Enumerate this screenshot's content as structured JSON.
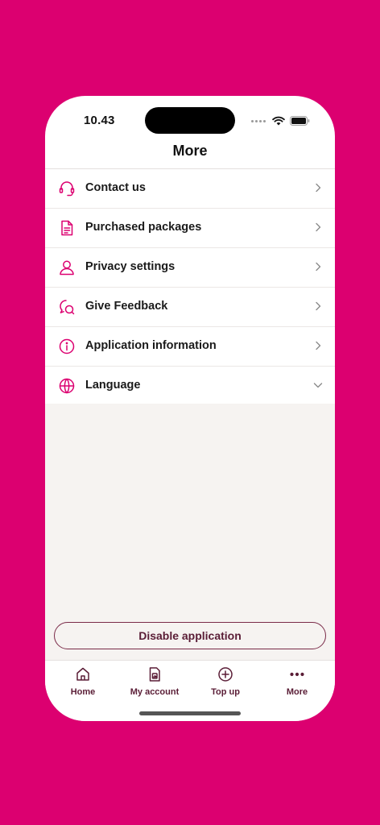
{
  "status_bar": {
    "time": "10.43"
  },
  "header": {
    "title": "More"
  },
  "menu": {
    "items": [
      {
        "label": "Contact us",
        "icon": "headset-icon",
        "indicator": "chevron-right"
      },
      {
        "label": "Purchased packages",
        "icon": "document-icon",
        "indicator": "chevron-right"
      },
      {
        "label": "Privacy settings",
        "icon": "user-icon",
        "indicator": "chevron-right"
      },
      {
        "label": "Give Feedback",
        "icon": "feedback-icon",
        "indicator": "chevron-right"
      },
      {
        "label": "Application information",
        "icon": "info-icon",
        "indicator": "chevron-right"
      },
      {
        "label": "Language",
        "icon": "globe-icon",
        "indicator": "chevron-down"
      }
    ]
  },
  "actions": {
    "disable_label": "Disable application"
  },
  "tabbar": {
    "tabs": [
      {
        "label": "Home",
        "icon": "home-icon"
      },
      {
        "label": "My account",
        "icon": "sim-card-icon"
      },
      {
        "label": "Top up",
        "icon": "plus-circle-icon"
      },
      {
        "label": "More",
        "icon": "more-dots-icon"
      }
    ]
  },
  "colors": {
    "background": "#dc0070",
    "accent": "#dc0070",
    "dark_accent": "#5a1d36",
    "content_bg": "#f6f3f1"
  }
}
